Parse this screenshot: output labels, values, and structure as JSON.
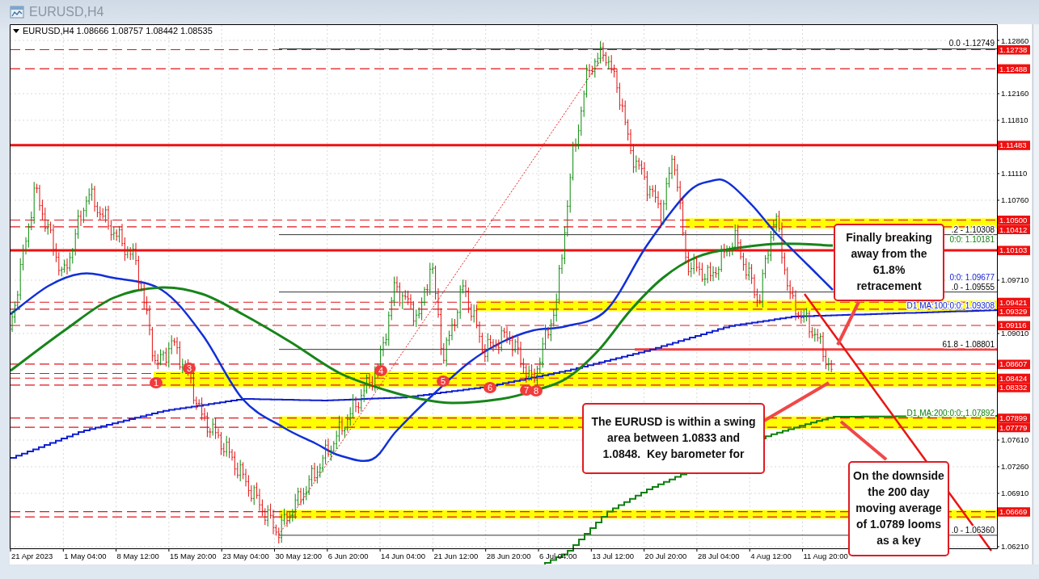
{
  "window": {
    "title": "EURUSD,H4"
  },
  "chart": {
    "header": "EURUSD,H4  1.08666 1.08757 1.08442 1.08535",
    "price_axis": [
      "1.12860",
      "1.12160",
      "1.11810",
      "1.11110",
      "1.10760",
      "1.09710",
      "1.09010",
      "1.07610",
      "1.07260",
      "1.06910",
      "1.06210"
    ],
    "price_tags": [
      {
        "text": "1.12738"
      },
      {
        "text": "1.12488"
      },
      {
        "text": "1.11483"
      },
      {
        "text": "1.10500"
      },
      {
        "text": "1.10412"
      },
      {
        "text": "1.10103"
      },
      {
        "text": "1.09421"
      },
      {
        "text": "1.09329"
      },
      {
        "text": "1.09116"
      },
      {
        "text": "1.08607"
      },
      {
        "text": "1.08424"
      },
      {
        "text": "1.08332"
      },
      {
        "text": "1.07899"
      },
      {
        "text": "1.07779"
      },
      {
        "text": "1.06669"
      }
    ],
    "time_axis": [
      "21 Apr 2023",
      "1 May 04:00",
      "8 May 12:00",
      "15 May 20:00",
      "23 May 04:00",
      "30 May 12:00",
      "6 Jun 20:00",
      "14 Jun 04:00",
      "21 Jun 12:00",
      "28 Jun 20:00",
      "6 Jul 04:00",
      "13 Jul 12:00",
      "20 Jul 20:00",
      "28 Jul 04:00",
      "4 Aug 12:00",
      "11 Aug 20:00"
    ],
    "level_labels": [
      {
        "text": "0.0 -1.12749",
        "kind": "fib"
      },
      {
        "text": ".2 - 1.10308",
        "kind": "fib"
      },
      {
        "text": "0:0: 1.10181",
        "kind": "ma200"
      },
      {
        "text": "0:0: 1.09677",
        "kind": "ma100"
      },
      {
        "text": ".0 - 1.09555",
        "kind": "fib"
      },
      {
        "text": "D1 MA:100:0:0: 1.09308",
        "kind": "ma100"
      },
      {
        "text": "61.8 - 1.08801",
        "kind": "fib"
      },
      {
        "text": "D1 MA:200:0:0: 1.07892",
        "kind": "ma200"
      },
      {
        "text": ".0 - 1.06360",
        "kind": "fib"
      }
    ],
    "markers": [
      "1",
      "3",
      "4",
      "5",
      "6",
      "7",
      "8"
    ],
    "callouts": [
      "Finally breaking away from the 61.8% retracement",
      "The EURUSD is within a swing area between 1.0833 and 1.0848.  Key barometer for",
      "On the downside the 200 day moving average of 1.0789 looms as a key"
    ]
  }
}
